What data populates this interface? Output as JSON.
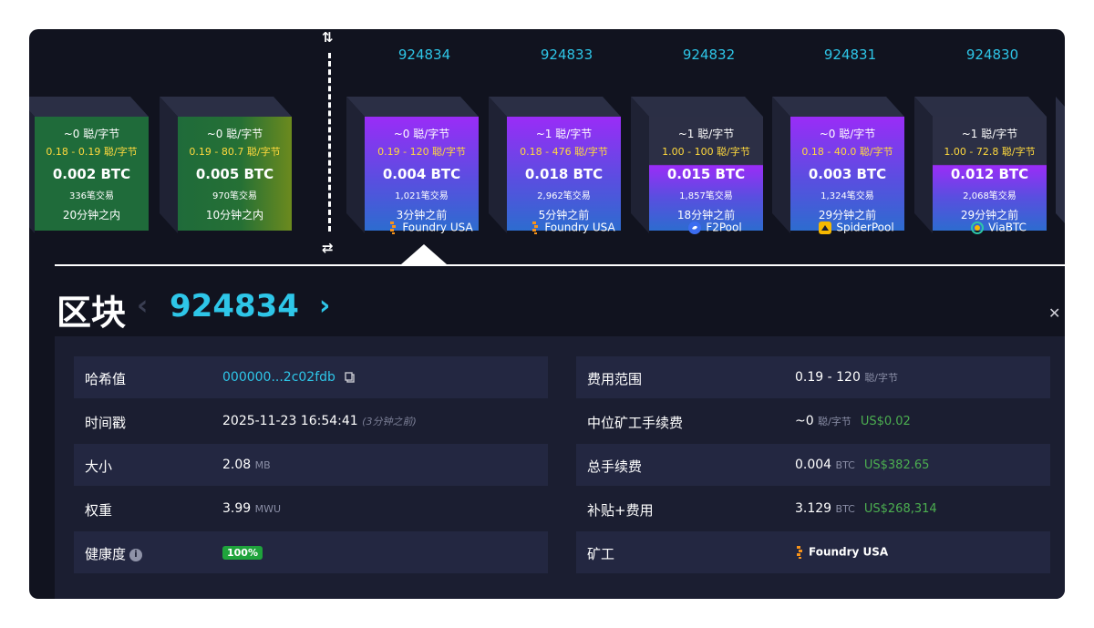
{
  "future_blocks": [
    {
      "fee": "~0 聪/字节",
      "range": "0.18 - 0.19 聪/字节",
      "total": "0.002 BTC",
      "tx": "336笔交易",
      "eta": "20分钟之内"
    },
    {
      "fee": "~0 聪/字节",
      "range": "0.19 - 80.7 聪/字节",
      "total": "0.005 BTC",
      "tx": "970笔交易",
      "eta": "10分钟之内"
    }
  ],
  "mined_blocks": [
    {
      "height": "924834",
      "fee": "~0 聪/字节",
      "range": "0.19 - 120 聪/字节",
      "total": "0.004 BTC",
      "tx": "1,021笔交易",
      "age": "3分钟之前",
      "pool": "Foundry USA",
      "pool_icon": "foundry-icon"
    },
    {
      "height": "924833",
      "fee": "~1 聪/字节",
      "range": "0.18 - 476 聪/字节",
      "total": "0.018 BTC",
      "tx": "2,962笔交易",
      "age": "5分钟之前",
      "pool": "Foundry USA",
      "pool_icon": "foundry-icon"
    },
    {
      "height": "924832",
      "fee": "~1 聪/字节",
      "range": "1.00 - 100 聪/字节",
      "total": "0.015 BTC",
      "tx": "1,857笔交易",
      "age": "18分钟之前",
      "pool": "F2Pool",
      "pool_icon": "f2pool-icon"
    },
    {
      "height": "924831",
      "fee": "~0 聪/字节",
      "range": "0.18 - 40.0 聪/字节",
      "total": "0.003 BTC",
      "tx": "1,324笔交易",
      "age": "29分钟之前",
      "pool": "SpiderPool",
      "pool_icon": "spiderpool-icon"
    },
    {
      "height": "924830",
      "fee": "~1 聪/字节",
      "range": "1.00 - 72.8 聪/字节",
      "total": "0.012 BTC",
      "tx": "2,068笔交易",
      "age": "29分钟之前",
      "pool": "ViaBTC",
      "pool_icon": "viabtc-icon"
    }
  ],
  "detail": {
    "title": "区块",
    "height": "924834",
    "left": [
      {
        "label": "哈希值",
        "value": "000000...2c02fdb"
      },
      {
        "label": "时间戳",
        "value": "2025-11-23 16:54:41",
        "note": "(3分钟之前)"
      },
      {
        "label": "大小",
        "value": "2.08",
        "unit": "MB"
      },
      {
        "label": "权重",
        "value": "3.99",
        "unit": "MWU"
      },
      {
        "label": "健康度",
        "value": "100%"
      }
    ],
    "right": [
      {
        "label": "费用范围",
        "value": "0.19 - 120",
        "unit": "聪/字节"
      },
      {
        "label": "中位矿工手续费",
        "value": "~0",
        "unit": "聪/字节",
        "usd": "US$0.02"
      },
      {
        "label": "总手续费",
        "value": "0.004",
        "unit": "BTC",
        "usd": "US$382.65"
      },
      {
        "label": "补贴+费用",
        "value": "3.129",
        "unit": "BTC",
        "usd": "US$268,314"
      },
      {
        "label": "矿工",
        "value": "Foundry USA"
      }
    ]
  },
  "icons": {
    "swap_top": "swap-vertical-icon",
    "swap_bottom": "swap-horizontal-icon",
    "prev": "chevron-left-icon",
    "next": "chevron-right-icon",
    "close": "close-icon",
    "copy": "copy-icon",
    "info": "info-icon"
  },
  "colors": {
    "accent": "#2ec6e8",
    "range_text": "#ffd93d",
    "usd": "#4caf50",
    "health": "#1fa33c"
  }
}
